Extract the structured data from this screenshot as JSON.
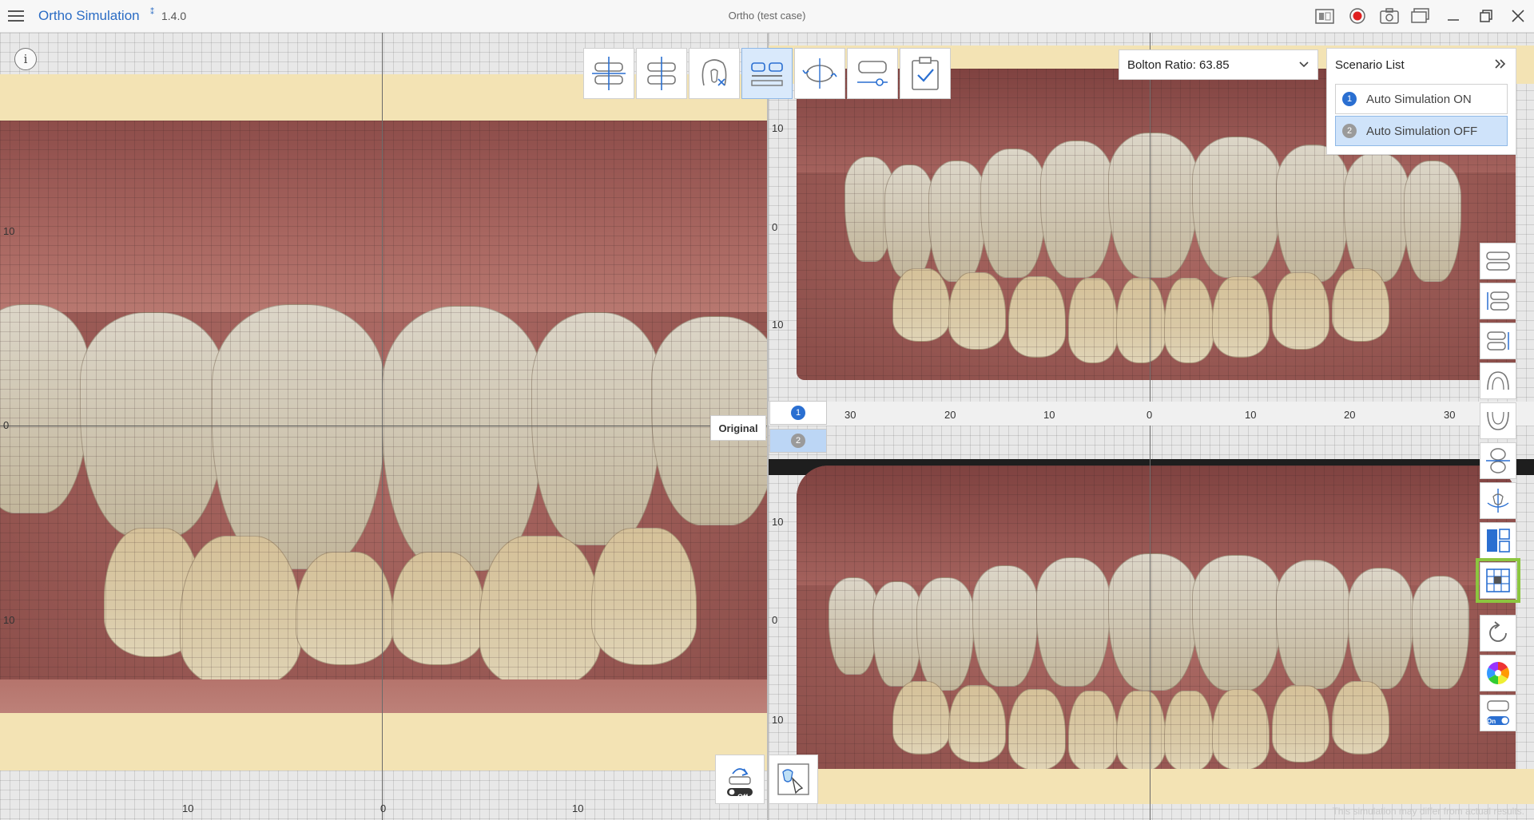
{
  "titlebar": {
    "app_name": "Ortho Simulation",
    "app_icon": "ai-icon",
    "version": "1.4.0",
    "case_title": "Ortho (test case)"
  },
  "toolbar": {
    "icons": [
      "arch-alignment-icon",
      "midline-icon",
      "tooth-remove-icon",
      "occlusion-split-icon",
      "rotate-view-icon",
      "arch-adjust-icon",
      "confirm-clipboard-icon"
    ],
    "active_index": 3
  },
  "bolton": {
    "label": "Bolton Ratio: 63.85"
  },
  "scenario": {
    "title": "Scenario List",
    "items": [
      {
        "num": "1",
        "label": "Auto Simulation ON",
        "selected": false
      },
      {
        "num": "2",
        "label": "Auto Simulation OFF",
        "selected": true
      }
    ]
  },
  "left_view": {
    "ruler_y": [
      "10",
      "0",
      "10"
    ],
    "ruler_x": [
      "10",
      "0",
      "10"
    ],
    "original_label": "Original"
  },
  "right_view": {
    "top_ruler_y": [
      "10",
      "0",
      "10"
    ],
    "bottom_ruler_y": [
      "10",
      "0",
      "10"
    ],
    "ruler_x": [
      "30",
      "20",
      "10",
      "0",
      "10",
      "20",
      "30"
    ],
    "tabs": [
      {
        "num": "1"
      },
      {
        "num": "2"
      }
    ]
  },
  "side_tools": {
    "icons": [
      "front-view-icon",
      "left-view-icon",
      "right-view-icon",
      "upper-arch-icon",
      "lower-arch-icon",
      "split-jaw-icon",
      "smile-line-icon",
      "layout-icon",
      "grid-icon",
      "reset-icon",
      "color-wheel-icon",
      "toggle-on-icon"
    ],
    "highlight_index": 8,
    "toggle_label": "On"
  },
  "bottom_tools": {
    "auto_label": "Off",
    "icons": [
      "auto-adjust-icon",
      "touch-select-icon"
    ]
  },
  "disclaimer": "This simulation may differ from actual results."
}
